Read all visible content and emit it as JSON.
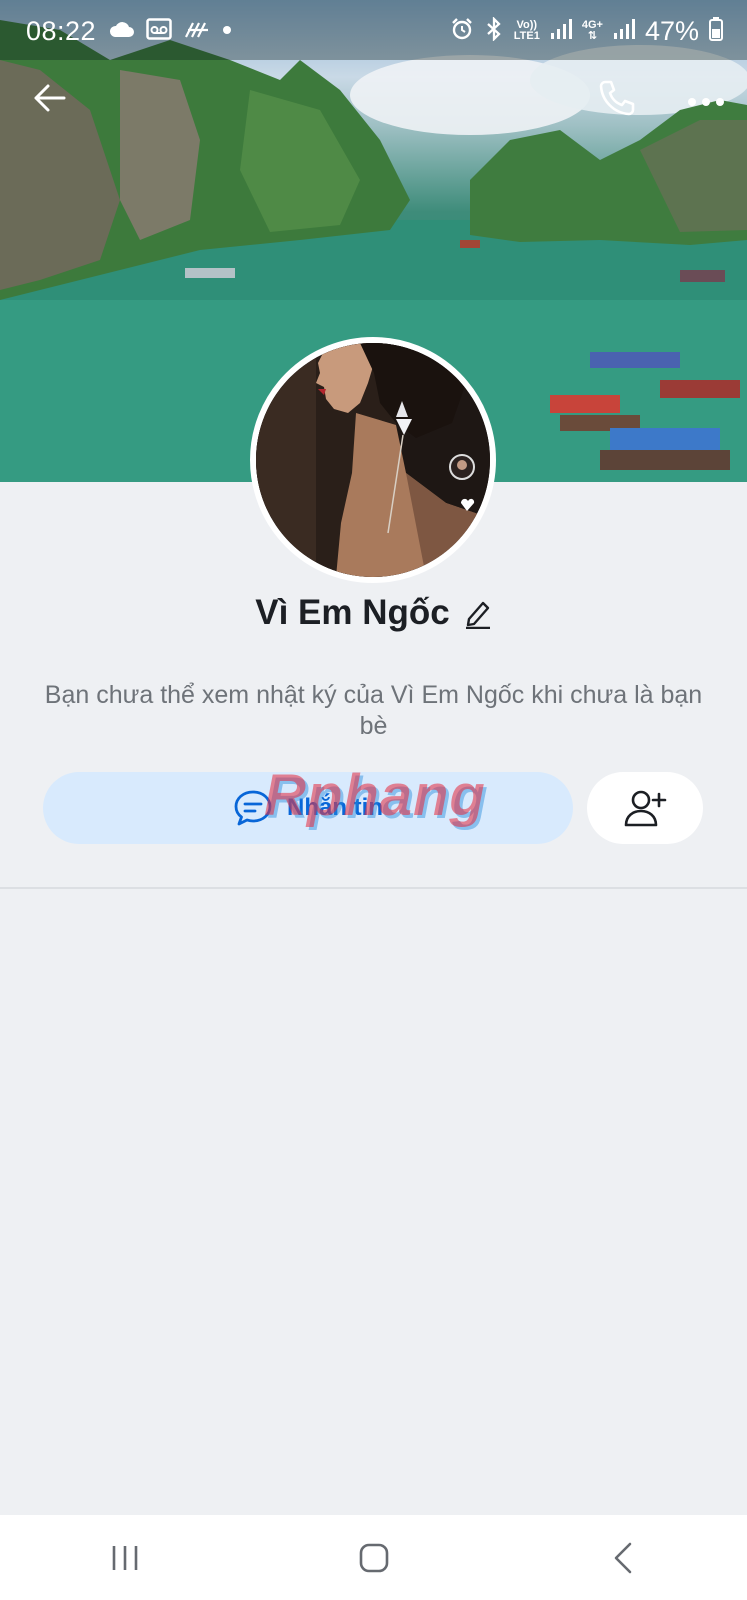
{
  "status_bar": {
    "time": "08:22",
    "network_top": "Vo))",
    "network_bottom": "LTE1",
    "net_4g": "4G+",
    "battery": "47%"
  },
  "app_bar": {
    "back_icon": "arrow-left-icon",
    "call_icon": "phone-icon",
    "more_icon": "more-horizontal-icon"
  },
  "profile": {
    "name": "Vì Em Ngốc",
    "notice": "Bạn chưa thể xem nhật ký của Vì Em Ngốc khi chưa là bạn bè"
  },
  "actions": {
    "message_label": "Nhắn tin",
    "add_friend_icon": "add-user-icon"
  },
  "watermark": "Rphang",
  "colors": {
    "accent": "#0866d8",
    "message_button_bg": "#d8eafd",
    "page_bg": "#eef0f3"
  }
}
